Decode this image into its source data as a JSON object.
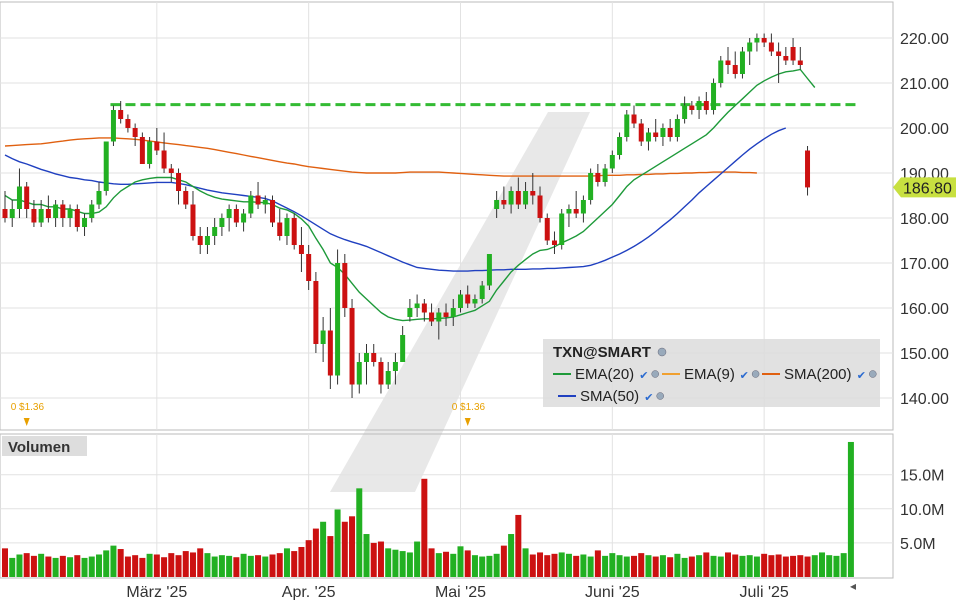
{
  "chart_data": {
    "type": "candlestick",
    "symbol": "TXN@SMART",
    "price_axis": {
      "ticks": [
        140,
        150,
        160,
        170,
        180,
        190,
        200,
        210,
        220
      ],
      "tick_labels": [
        "140.00",
        "150.00",
        "160.00",
        "170.00",
        "180.00",
        "190.00",
        "200.00",
        "210.00",
        "220.00"
      ],
      "range": [
        134,
        222
      ]
    },
    "last_price": {
      "label": "186.80",
      "value": 186.8
    },
    "resistance_line": {
      "value": 205.2,
      "color": "#33bb33",
      "style": "dashed"
    },
    "x_axis": {
      "labels": [
        "März '25",
        "Apr. '25",
        "Mai '25",
        "Juni '25",
        "Juli '25"
      ],
      "label_index": [
        21,
        42,
        63,
        84,
        105
      ]
    },
    "dividends": [
      {
        "label": "0 $1.36",
        "index": 3
      },
      {
        "label": "0 $1.36",
        "index": 64
      }
    ],
    "candles": [
      {
        "o": 182,
        "h": 186,
        "l": 179,
        "c": 180
      },
      {
        "o": 180,
        "h": 184,
        "l": 178,
        "c": 182
      },
      {
        "o": 182,
        "h": 191,
        "l": 180,
        "c": 187
      },
      {
        "o": 187,
        "h": 188,
        "l": 180,
        "c": 182
      },
      {
        "o": 182,
        "h": 184,
        "l": 178,
        "c": 179
      },
      {
        "o": 179,
        "h": 184,
        "l": 178,
        "c": 182
      },
      {
        "o": 182,
        "h": 185,
        "l": 179,
        "c": 180
      },
      {
        "o": 180,
        "h": 184,
        "l": 178,
        "c": 183
      },
      {
        "o": 183,
        "h": 184,
        "l": 178,
        "c": 180
      },
      {
        "o": 180,
        "h": 183,
        "l": 178,
        "c": 182
      },
      {
        "o": 182,
        "h": 183,
        "l": 177,
        "c": 178
      },
      {
        "o": 178,
        "h": 181,
        "l": 176,
        "c": 180
      },
      {
        "o": 180,
        "h": 184,
        "l": 179,
        "c": 183
      },
      {
        "o": 183,
        "h": 188,
        "l": 182,
        "c": 186
      },
      {
        "o": 186,
        "h": 197,
        "l": 185,
        "c": 197
      },
      {
        "o": 197,
        "h": 205,
        "l": 196,
        "c": 204
      },
      {
        "o": 204,
        "h": 206,
        "l": 201,
        "c": 202
      },
      {
        "o": 202,
        "h": 203,
        "l": 199,
        "c": 200
      },
      {
        "o": 200,
        "h": 201,
        "l": 196,
        "c": 198
      },
      {
        "o": 198,
        "h": 199,
        "l": 192,
        "c": 192
      },
      {
        "o": 192,
        "h": 198,
        "l": 191,
        "c": 197
      },
      {
        "o": 197,
        "h": 200,
        "l": 194,
        "c": 195
      },
      {
        "o": 195,
        "h": 199,
        "l": 190,
        "c": 191
      },
      {
        "o": 191,
        "h": 192,
        "l": 188,
        "c": 190
      },
      {
        "o": 190,
        "h": 191,
        "l": 183,
        "c": 186
      },
      {
        "o": 186,
        "h": 187,
        "l": 182,
        "c": 183
      },
      {
        "o": 183,
        "h": 186,
        "l": 175,
        "c": 176
      },
      {
        "o": 176,
        "h": 178,
        "l": 172,
        "c": 174
      },
      {
        "o": 174,
        "h": 178,
        "l": 172,
        "c": 176
      },
      {
        "o": 176,
        "h": 180,
        "l": 174,
        "c": 178
      },
      {
        "o": 178,
        "h": 181,
        "l": 176,
        "c": 180
      },
      {
        "o": 180,
        "h": 183,
        "l": 177,
        "c": 182
      },
      {
        "o": 182,
        "h": 183,
        "l": 178,
        "c": 179
      },
      {
        "o": 179,
        "h": 182,
        "l": 177,
        "c": 181
      },
      {
        "o": 181,
        "h": 186,
        "l": 180,
        "c": 185
      },
      {
        "o": 185,
        "h": 188,
        "l": 182,
        "c": 183
      },
      {
        "o": 183,
        "h": 185,
        "l": 181,
        "c": 184
      },
      {
        "o": 184,
        "h": 185,
        "l": 178,
        "c": 179
      },
      {
        "o": 179,
        "h": 182,
        "l": 175,
        "c": 176
      },
      {
        "o": 176,
        "h": 181,
        "l": 174,
        "c": 180
      },
      {
        "o": 180,
        "h": 181,
        "l": 173,
        "c": 174
      },
      {
        "o": 174,
        "h": 178,
        "l": 168,
        "c": 172
      },
      {
        "o": 172,
        "h": 174,
        "l": 164,
        "c": 166
      },
      {
        "o": 166,
        "h": 168,
        "l": 150,
        "c": 152
      },
      {
        "o": 152,
        "h": 158,
        "l": 148,
        "c": 155
      },
      {
        "o": 155,
        "h": 160,
        "l": 142,
        "c": 145
      },
      {
        "o": 145,
        "h": 173,
        "l": 143,
        "c": 170
      },
      {
        "o": 170,
        "h": 172,
        "l": 158,
        "c": 160
      },
      {
        "o": 160,
        "h": 162,
        "l": 140,
        "c": 143
      },
      {
        "o": 143,
        "h": 150,
        "l": 141,
        "c": 148
      },
      {
        "o": 148,
        "h": 152,
        "l": 143,
        "c": 150
      },
      {
        "o": 150,
        "h": 152,
        "l": 147,
        "c": 148
      },
      {
        "o": 148,
        "h": 149,
        "l": 141,
        "c": 143
      },
      {
        "o": 143,
        "h": 148,
        "l": 142,
        "c": 146
      },
      {
        "o": 146,
        "h": 150,
        "l": 143,
        "c": 148
      },
      {
        "o": 148,
        "h": 156,
        "l": 148,
        "c": 154
      },
      {
        "o": 158,
        "h": 162,
        "l": 157,
        "c": 160
      },
      {
        "o": 160,
        "h": 163,
        "l": 158,
        "c": 161
      },
      {
        "o": 161,
        "h": 162,
        "l": 157,
        "c": 159
      },
      {
        "o": 159,
        "h": 161,
        "l": 156,
        "c": 157
      },
      {
        "o": 157,
        "h": 160,
        "l": 153,
        "c": 159
      },
      {
        "o": 159,
        "h": 161,
        "l": 156,
        "c": 158
      },
      {
        "o": 158,
        "h": 162,
        "l": 156,
        "c": 160
      },
      {
        "o": 160,
        "h": 164,
        "l": 159,
        "c": 163
      },
      {
        "o": 163,
        "h": 165,
        "l": 160,
        "c": 161
      },
      {
        "o": 161,
        "h": 163,
        "l": 160,
        "c": 162
      },
      {
        "o": 162,
        "h": 166,
        "l": 161,
        "c": 165
      },
      {
        "o": 165,
        "h": 172,
        "l": 164,
        "c": 172
      },
      {
        "o": 182,
        "h": 186,
        "l": 180,
        "c": 184
      },
      {
        "o": 184,
        "h": 187,
        "l": 182,
        "c": 183
      },
      {
        "o": 183,
        "h": 187,
        "l": 181,
        "c": 186
      },
      {
        "o": 186,
        "h": 189,
        "l": 182,
        "c": 183
      },
      {
        "o": 183,
        "h": 188,
        "l": 182,
        "c": 186
      },
      {
        "o": 186,
        "h": 190,
        "l": 183,
        "c": 185
      },
      {
        "o": 185,
        "h": 187,
        "l": 179,
        "c": 180
      },
      {
        "o": 180,
        "h": 181,
        "l": 174,
        "c": 175
      },
      {
        "o": 175,
        "h": 177,
        "l": 172,
        "c": 174
      },
      {
        "o": 174,
        "h": 182,
        "l": 173,
        "c": 181
      },
      {
        "o": 181,
        "h": 183,
        "l": 178,
        "c": 182
      },
      {
        "o": 182,
        "h": 186,
        "l": 180,
        "c": 181
      },
      {
        "o": 181,
        "h": 185,
        "l": 179,
        "c": 184
      },
      {
        "o": 184,
        "h": 191,
        "l": 183,
        "c": 190
      },
      {
        "o": 190,
        "h": 192,
        "l": 187,
        "c": 188
      },
      {
        "o": 188,
        "h": 192,
        "l": 187,
        "c": 191
      },
      {
        "o": 191,
        "h": 195,
        "l": 190,
        "c": 194
      },
      {
        "o": 194,
        "h": 199,
        "l": 193,
        "c": 198
      },
      {
        "o": 198,
        "h": 204,
        "l": 197,
        "c": 203
      },
      {
        "o": 203,
        "h": 205,
        "l": 200,
        "c": 201
      },
      {
        "o": 201,
        "h": 202,
        "l": 196,
        "c": 197
      },
      {
        "o": 197,
        "h": 200,
        "l": 195,
        "c": 199
      },
      {
        "o": 199,
        "h": 202,
        "l": 197,
        "c": 198
      },
      {
        "o": 198,
        "h": 201,
        "l": 196,
        "c": 200
      },
      {
        "o": 200,
        "h": 202,
        "l": 197,
        "c": 198
      },
      {
        "o": 198,
        "h": 203,
        "l": 197,
        "c": 202
      },
      {
        "o": 202,
        "h": 207,
        "l": 201,
        "c": 205
      },
      {
        "o": 205,
        "h": 206,
        "l": 203,
        "c": 204
      },
      {
        "o": 204,
        "h": 207,
        "l": 202,
        "c": 206
      },
      {
        "o": 206,
        "h": 208,
        "l": 203,
        "c": 204
      },
      {
        "o": 204,
        "h": 211,
        "l": 203,
        "c": 210
      },
      {
        "o": 210,
        "h": 216,
        "l": 209,
        "c": 215
      },
      {
        "o": 215,
        "h": 218,
        "l": 212,
        "c": 214
      },
      {
        "o": 214,
        "h": 217,
        "l": 211,
        "c": 212
      },
      {
        "o": 212,
        "h": 218,
        "l": 211,
        "c": 217
      },
      {
        "o": 217,
        "h": 220,
        "l": 214,
        "c": 219
      },
      {
        "o": 219,
        "h": 221,
        "l": 217,
        "c": 220
      },
      {
        "o": 220,
        "h": 221,
        "l": 218,
        "c": 219
      },
      {
        "o": 219,
        "h": 221,
        "l": 216,
        "c": 217
      },
      {
        "o": 217,
        "h": 219,
        "l": 210,
        "c": 216
      },
      {
        "o": 216,
        "h": 218,
        "l": 214,
        "c": 215
      },
      {
        "o": 218,
        "h": 220,
        "l": 214,
        "c": 215
      },
      {
        "o": 215,
        "h": 218,
        "l": 213,
        "c": 214
      },
      {
        "o": 195,
        "h": 196,
        "l": 185,
        "c": 186.8
      }
    ],
    "ema20": [
      185,
      184,
      184,
      183.5,
      183,
      183,
      182.5,
      182.5,
      182,
      182,
      181.5,
      181,
      181,
      181.3,
      182.5,
      184.5,
      186,
      187,
      188,
      188.5,
      188.8,
      189,
      189,
      189,
      188.5,
      188,
      187,
      186,
      185.2,
      184.6,
      184.2,
      184,
      183.8,
      183.6,
      183.6,
      183.5,
      183.4,
      183,
      182.2,
      181.8,
      181,
      179.8,
      178.2,
      175.5,
      173,
      170,
      169,
      167.5,
      165.5,
      163.5,
      162,
      160.5,
      159,
      158,
      157.5,
      157.2,
      157.3,
      157.5,
      157.6,
      157.6,
      157.7,
      157.8,
      158,
      158.5,
      159,
      159.5,
      160.5,
      161.5,
      164,
      166,
      168,
      169.5,
      170.8,
      172,
      172.8,
      173,
      173.6,
      174.5,
      175.2,
      176,
      177,
      178.5,
      180,
      181.5,
      183,
      185,
      187,
      188.5,
      189.5,
      190.5,
      191.5,
      192.5,
      193.5,
      194.5,
      195.5,
      196.5,
      197.5,
      198.5,
      200,
      201.8,
      203.5,
      205,
      206.5,
      208,
      209.5,
      210.5,
      211.3,
      212,
      212.5,
      212.7,
      213,
      211,
      209
    ],
    "sma50": [
      194,
      193.2,
      192.5,
      192,
      191.4,
      190.8,
      190.3,
      189.8,
      189.4,
      189,
      188.8,
      188.5,
      188.3,
      188,
      187.8,
      187.6,
      187.5,
      187.5,
      187.6,
      187.7,
      187.8,
      187.9,
      187.9,
      187.9,
      187.7,
      187.4,
      187,
      186.6,
      186.2,
      185.9,
      185.6,
      185.4,
      185.2,
      185,
      184.8,
      184.6,
      184.3,
      183.8,
      183,
      182.2,
      181.4,
      180.5,
      179.5,
      178.5,
      177.5,
      176.5,
      175.8,
      175.2,
      174.7,
      174.2,
      173.7,
      173,
      172.3,
      171.6,
      170.9,
      170.2,
      169.6,
      169,
      168.8,
      168.6,
      168.4,
      168.3,
      168.2,
      168.2,
      168.2,
      168.3,
      168.3,
      168.4,
      168.5,
      168.5,
      168.6,
      168.6,
      168.6,
      168.7,
      168.7,
      168.8,
      168.8,
      168.9,
      169,
      169.1,
      169.2,
      169.5,
      170,
      170.6,
      171.3,
      172,
      172.8,
      173.7,
      174.7,
      175.8,
      177,
      178.3,
      179.6,
      181,
      182.5,
      184,
      185.6,
      187,
      188.4,
      189.8,
      191.2,
      192.6,
      194,
      195.3,
      196.5,
      197.6,
      198.6,
      199.4,
      200
    ],
    "sma200": [
      196,
      196.1,
      196.2,
      196.3,
      196.4,
      196.5,
      196.7,
      196.9,
      197.1,
      197.3,
      197.5,
      197.6,
      197.7,
      197.8,
      197.8,
      197.8,
      197.7,
      197.6,
      197.5,
      197.3,
      197.1,
      196.9,
      196.7,
      196.5,
      196.3,
      196.1,
      195.9,
      195.7,
      195.5,
      195.2,
      194.9,
      194.6,
      194.3,
      194,
      193.7,
      193.4,
      193.1,
      192.8,
      192.5,
      192.2,
      192,
      191.7,
      191.4,
      191.2,
      191,
      190.8,
      190.6,
      190.4,
      190.2,
      190.1,
      190,
      190,
      190,
      190,
      190,
      190.1,
      190.2,
      190.2,
      190.2,
      190.2,
      190.2,
      190.1,
      190,
      189.9,
      189.8,
      189.7,
      189.6,
      189.5,
      189.4,
      189.3,
      189.3,
      189.3,
      189.3,
      189.3,
      189.3,
      189.3,
      189.3,
      189.3,
      189.3,
      189.3,
      189.3,
      189.3,
      189.4,
      189.5,
      189.5,
      189.5,
      189.6,
      189.6,
      189.7,
      189.7,
      189.8,
      189.8,
      189.9,
      189.9,
      190,
      190,
      190.1,
      190.1,
      190.2,
      190.2,
      190.2,
      190.2,
      190.1,
      190.1,
      190
    ],
    "volume_axis": {
      "ticks": [
        5000000,
        10000000,
        15000000
      ],
      "tick_labels": [
        "5.0M",
        "10.0M",
        "15.0M"
      ]
    },
    "volume": [
      4.2,
      2.8,
      3.3,
      3.5,
      3.1,
      3.4,
      3.0,
      2.8,
      3.1,
      2.9,
      3.2,
      2.8,
      3.0,
      3.3,
      3.9,
      4.6,
      4.1,
      3.0,
      3.2,
      2.8,
      3.4,
      3.3,
      2.9,
      3.5,
      3.2,
      3.8,
      3.6,
      4.2,
      3.5,
      3.0,
      3.2,
      3.1,
      2.9,
      3.4,
      3.1,
      3.2,
      3.0,
      3.3,
      3.5,
      4.2,
      3.8,
      4.4,
      5.4,
      7.1,
      8.1,
      6.0,
      9.9,
      8.1,
      8.9,
      13.0,
      6.3,
      5.0,
      5.2,
      4.2,
      4.0,
      3.8,
      3.6,
      5.2,
      14.4,
      4.2,
      3.5,
      3.7,
      3.4,
      4.5,
      3.9,
      3.2,
      3.0,
      3.1,
      3.4,
      4.6,
      6.3,
      9.1,
      4.2,
      3.3,
      3.6,
      3.2,
      3.4,
      3.6,
      3.4,
      3.1,
      3.3,
      3.0,
      3.9,
      3.1,
      3.5,
      3.2,
      3.0,
      3.1,
      3.5,
      3.2,
      3.0,
      3.2,
      2.9,
      3.4,
      2.8,
      3.0,
      3.2,
      3.6,
      3.1,
      3.0,
      3.6,
      3.3,
      3.1,
      3.2,
      3.0,
      3.4,
      3.2,
      3.3,
      3.0,
      3.1,
      3.2,
      3.0,
      3.2,
      3.6,
      3.2,
      3.1,
      3.5,
      19.8
    ],
    "volume_colors": [
      "red",
      "green"
    ],
    "legend": {
      "title": "TXN@SMART",
      "items": [
        {
          "label": "EMA(20)",
          "color": "#1e9a3a"
        },
        {
          "label": "EMA(9)",
          "color": "#f0a030"
        },
        {
          "label": "SMA(200)",
          "color": "#e06010"
        },
        {
          "label": "SMA(50)",
          "color": "#2040c0"
        }
      ]
    },
    "volume_pane_label": "Volumen",
    "colors": {
      "up": "#22b022",
      "down": "#cc1111",
      "grid": "#dddddd",
      "price_tag": "#c8e040"
    }
  }
}
